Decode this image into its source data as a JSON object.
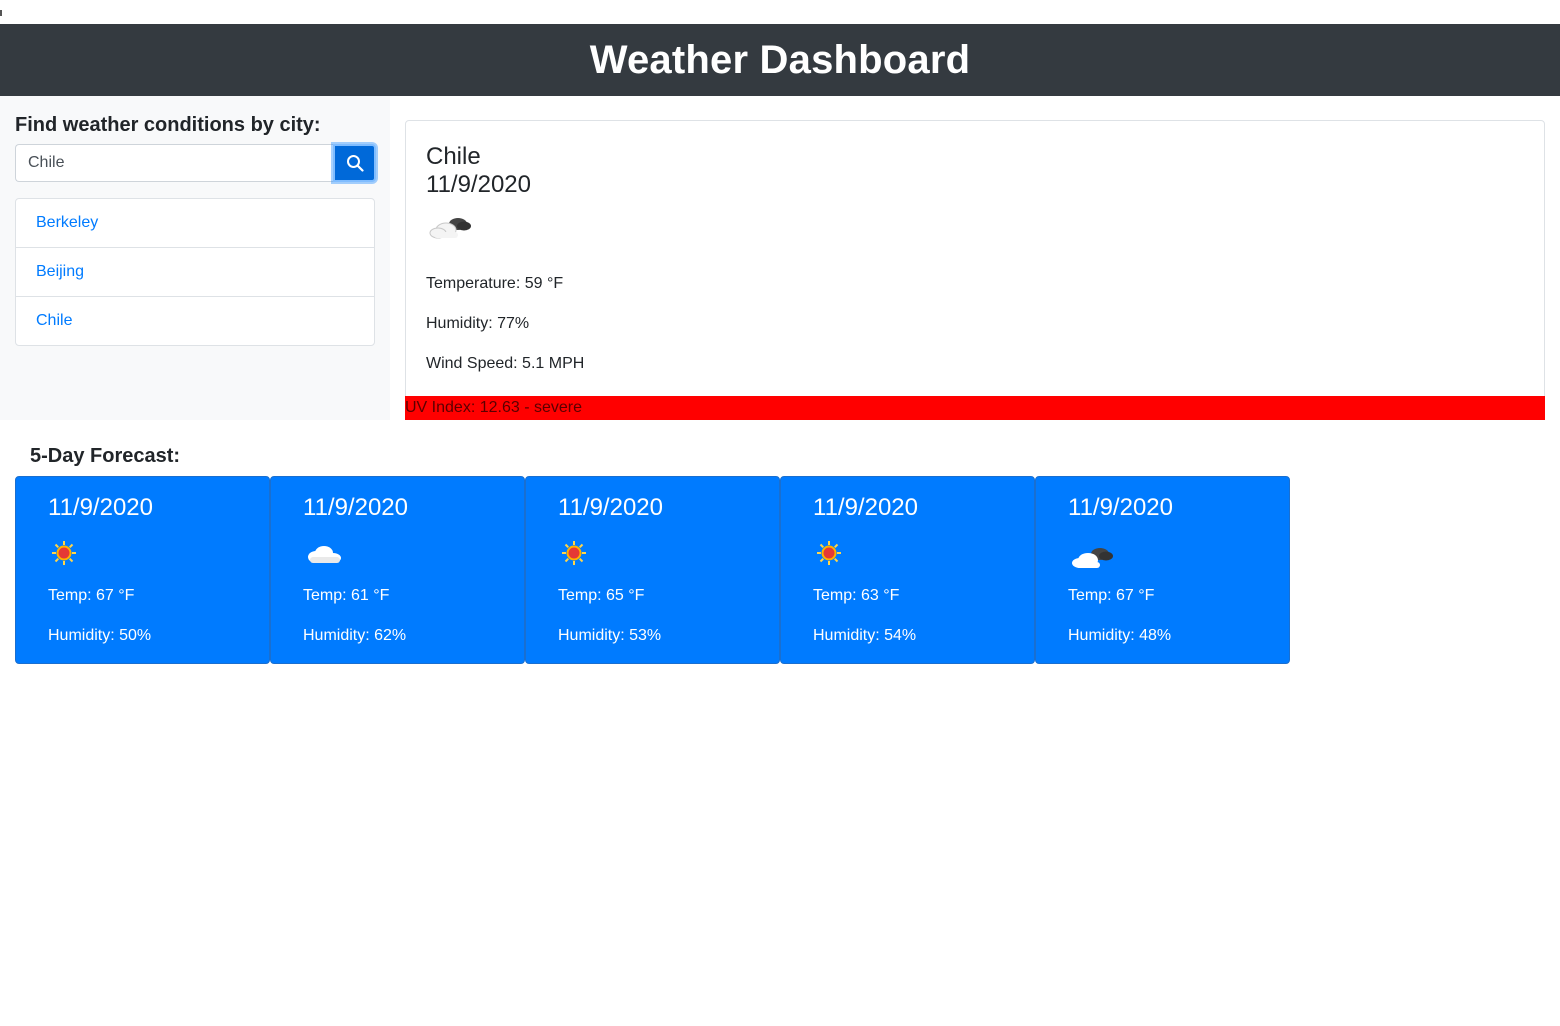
{
  "header": {
    "title": "Weather Dashboard"
  },
  "sidebar": {
    "heading": "Find weather conditions by city:",
    "search": {
      "value": "Chile",
      "button_icon": "search-icon"
    },
    "history": [
      {
        "label": "Berkeley"
      },
      {
        "label": "Beijing"
      },
      {
        "label": "Chile"
      }
    ]
  },
  "current": {
    "city": "Chile",
    "date": "11/9/2020",
    "icon": "partly-cloudy-icon",
    "temperature": "Temperature: 59 °F",
    "humidity": "Humidity: 77%",
    "wind": "Wind Speed: 5.1 MPH",
    "uv": "UV Index: 12.63 - severe"
  },
  "forecast": {
    "title": "5-Day Forecast:",
    "days": [
      {
        "date": "11/9/2020",
        "icon": "sun-icon",
        "temp": "Temp: 67 °F",
        "humidity": "Humidity: 50%"
      },
      {
        "date": "11/9/2020",
        "icon": "cloud-icon",
        "temp": "Temp: 61 °F",
        "humidity": "Humidity: 62%"
      },
      {
        "date": "11/9/2020",
        "icon": "sun-icon",
        "temp": "Temp: 65 °F",
        "humidity": "Humidity: 53%"
      },
      {
        "date": "11/9/2020",
        "icon": "sun-icon",
        "temp": "Temp: 63 °F",
        "humidity": "Humidity: 54%"
      },
      {
        "date": "11/9/2020",
        "icon": "partly-cloudy-icon",
        "temp": "Temp: 67 °F",
        "humidity": "Humidity: 48%"
      }
    ]
  },
  "colors": {
    "header_bg": "#343a40",
    "primary": "#007bff",
    "uv_severe": "#ff0000",
    "link": "#007bff"
  }
}
